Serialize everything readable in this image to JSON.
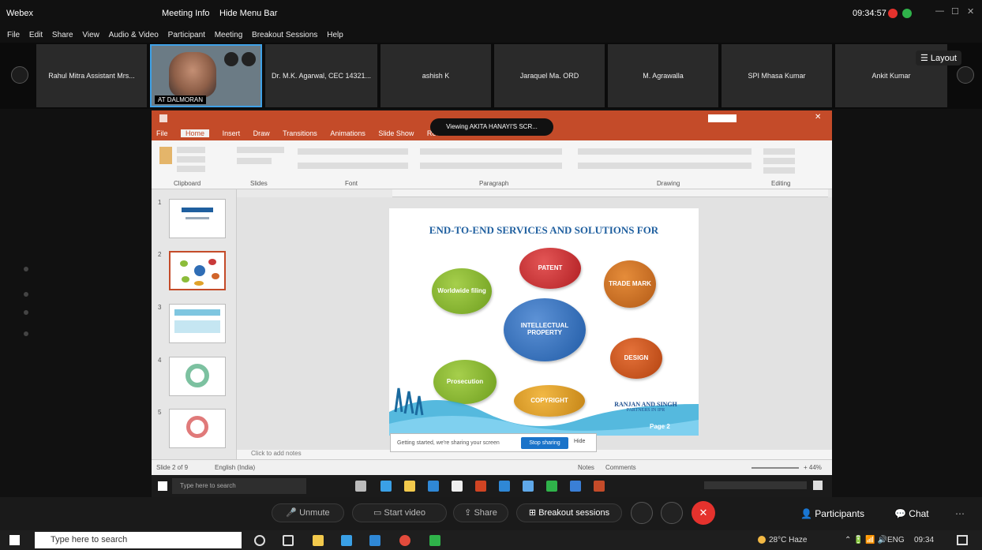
{
  "window": {
    "title_left": "Webex",
    "meeting_name": "Meeting Info",
    "hide_menu_bar": "Hide Menu Bar",
    "clock": "09:34:57"
  },
  "menu": [
    "File",
    "Edit",
    "Share",
    "View",
    "Audio & Video",
    "Participant",
    "Meeting",
    "Breakout Sessions",
    "Help"
  ],
  "participants": [
    {
      "name": "Rahul Mitra Assistant Mrs..."
    },
    {
      "name": "AT DALMORAN",
      "has_video": true
    },
    {
      "name": "Dr. M.K. Agarwal, CEC 14321..."
    },
    {
      "name": "ashish K"
    },
    {
      "name": "Jaraquel Ma. ORD"
    },
    {
      "name": "M. Agrawalla"
    },
    {
      "name": "SPI Mhasa Kumar"
    },
    {
      "name": "Ankit Kumar"
    }
  ],
  "layout_label": "Layout",
  "viewing_banner": "Viewing AKITA HANAYI'S SCR...",
  "powerpoint": {
    "tabs": [
      "File",
      "Home",
      "Insert",
      "Draw",
      "Transitions",
      "Animations",
      "Slide Show",
      "Review",
      "View"
    ],
    "active_tab": "Home",
    "ribbon_groups": [
      "Clipboard",
      "Slides",
      "Font",
      "Paragraph",
      "Drawing",
      "Editing"
    ],
    "notes_placeholder": "Click to add notes",
    "status_left": "Slide 2 of 9",
    "status_lang": "English (India)",
    "status_notes": "Notes",
    "status_comments": "Comments",
    "zoom": "+ 44%",
    "slide": {
      "heading": "END-TO-END SERVICES AND SOLUTIONS FOR",
      "center": "INTELLECTUAL PROPERTY",
      "orbs": [
        "PATENT",
        "TRADE MARK",
        "DESIGN",
        "COPYRIGHT",
        "Prosecution",
        "Worldwide filing"
      ],
      "signature_name": "RANJAN AND SINGH",
      "signature_sub": "PARTNERS IN IPR",
      "badge": "Page 2"
    },
    "share_notice": "Getting started, we're sharing your screen",
    "share_button": "Stop sharing",
    "share_hide": "Hide",
    "remote_search": "Type here to search"
  },
  "controls": {
    "unmute": "Unmute",
    "start_video": "Start video",
    "share": "Share",
    "breakout": "Breakout sessions",
    "participants": "Participants",
    "chat": "Chat"
  },
  "taskbar": {
    "search_placeholder": "Type here to search",
    "weather": "28°C Haze",
    "language": "ENG",
    "time": "09:34"
  },
  "colors": {
    "ppt_accent": "#c44b29",
    "end_call": "#e5322d",
    "share_button": "#1a73c9"
  }
}
